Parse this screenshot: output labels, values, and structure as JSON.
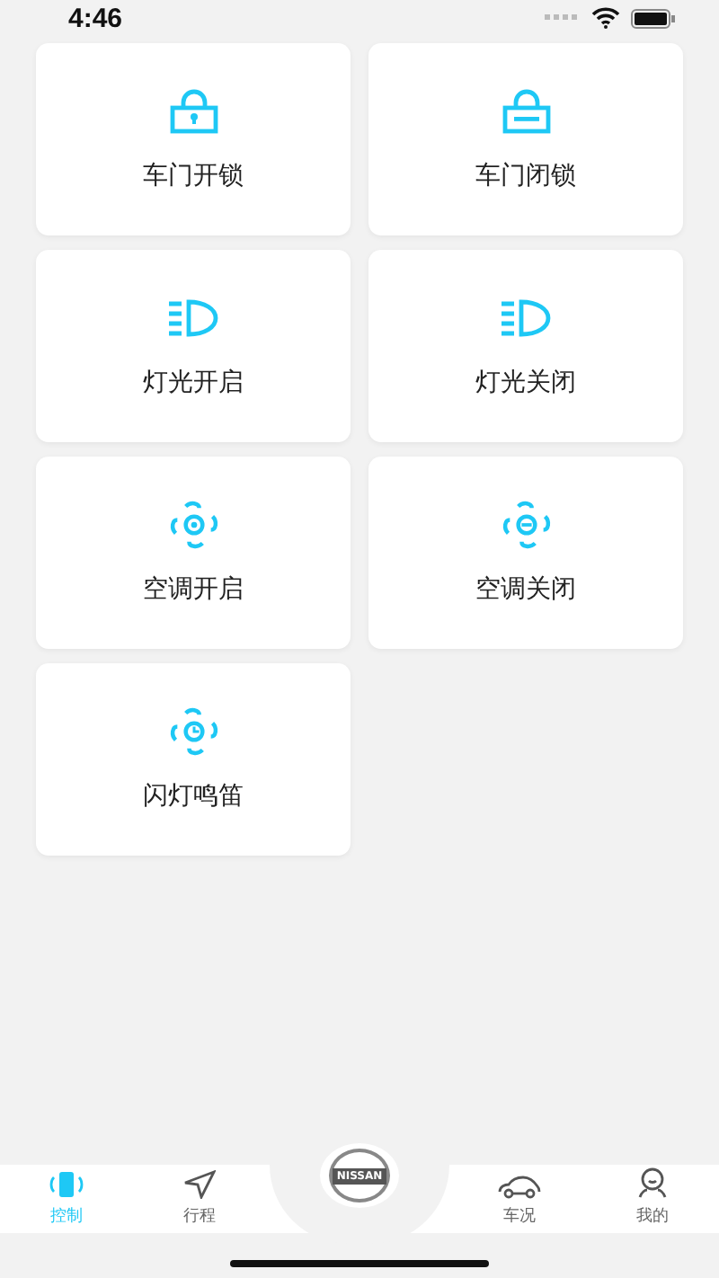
{
  "status_bar": {
    "time": "4:46"
  },
  "controls": [
    {
      "label": "车门开锁",
      "kind": "unlock"
    },
    {
      "label": "车门闭锁",
      "kind": "lock"
    },
    {
      "label": "灯光开启",
      "kind": "headlight"
    },
    {
      "label": "灯光关闭",
      "kind": "headlight"
    },
    {
      "label": "空调开启",
      "kind": "fan"
    },
    {
      "label": "空调关闭",
      "kind": "fanoff"
    },
    {
      "label": "闪灯鸣笛",
      "kind": "horn"
    }
  ],
  "tab_bar": {
    "logo": "NISSAN",
    "tabs": [
      {
        "label": "控制",
        "kind": "phone",
        "selected": true
      },
      {
        "label": "行程",
        "kind": "trip",
        "selected": false
      },
      {
        "label": "车况",
        "kind": "car",
        "selected": false
      },
      {
        "label": "我的",
        "kind": "profile",
        "selected": false
      }
    ]
  }
}
